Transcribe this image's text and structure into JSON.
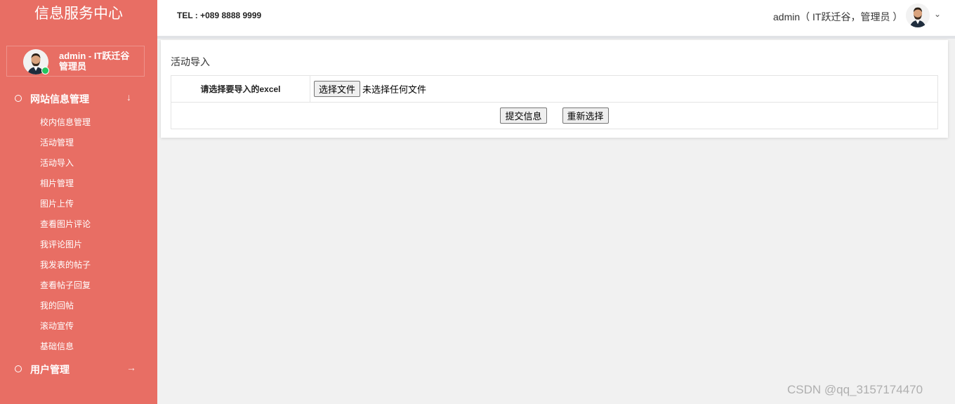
{
  "sidebar": {
    "brand": "信息服务中心",
    "user": {
      "name": "admin - IT跃迁谷",
      "role": "管理员",
      "status_color": "#22c55e"
    },
    "groups": [
      {
        "label": "网站信息管理",
        "arrow": "↓"
      },
      {
        "label": "用户管理",
        "arrow": "→"
      }
    ],
    "items": [
      "校内信息管理",
      "活动管理",
      "活动导入",
      "相片管理",
      "图片上传",
      "查看图片评论",
      "我评论图片",
      "我发表的帖子",
      "查看帖子回复",
      "我的回帖",
      "滚动宣传",
      "基础信息"
    ]
  },
  "header": {
    "tel": "TEL : +089 8888 9999",
    "user_label": "admin（ IT跃迁谷，管理员 ）",
    "chevron": "⌄"
  },
  "main": {
    "title": "活动导入",
    "form": {
      "label": "请选择要导入的excel",
      "file_button": "选择文件",
      "file_status": "未选择任何文件",
      "submit": "提交信息",
      "reset": "重新选择"
    }
  },
  "watermark": "CSDN @qq_3157174470",
  "colors": {
    "sidebar": "#e86e64",
    "background": "#f1f1f1"
  }
}
